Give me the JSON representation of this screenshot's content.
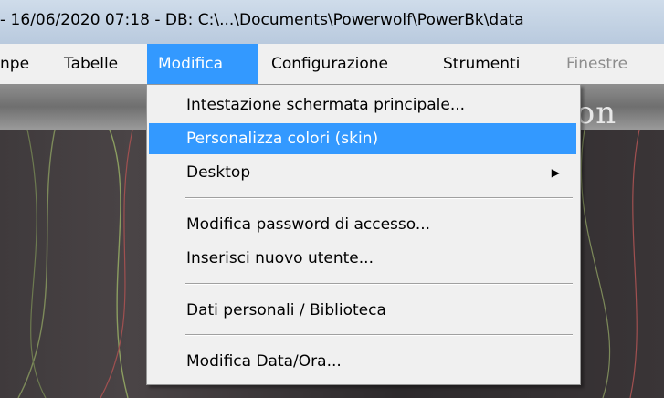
{
  "window": {
    "title": "- 16/06/2020 07:18 - DB: C:\\...\\Documents\\Powerwolf\\PowerBk\\data"
  },
  "menubar": {
    "items": [
      {
        "label": "npe"
      },
      {
        "label": "Tabelle"
      },
      {
        "label": "Modifica",
        "active": true
      },
      {
        "label": "Configurazione"
      },
      {
        "label": "Strumenti"
      },
      {
        "label": "Finestre",
        "disabled": true
      }
    ]
  },
  "background": {
    "banner_text": "zion"
  },
  "dropdown": {
    "items": [
      {
        "label": "Intestazione schermata principale..."
      },
      {
        "label": "Personalizza colori (skin)",
        "highlighted": true
      },
      {
        "label": "Desktop",
        "submenu_icon": "chevron-right-icon"
      },
      {
        "label": "Modifica password di accesso..."
      },
      {
        "label": "Inserisci nuovo utente..."
      },
      {
        "label": "Dati personali / Biblioteca"
      },
      {
        "label": "Modifica Data/Ora..."
      }
    ],
    "submenu_glyph": "▶"
  },
  "colors": {
    "highlight": "#3399ff",
    "menubar": "#f0f0f0",
    "titlebar": "#c4d3e4"
  }
}
